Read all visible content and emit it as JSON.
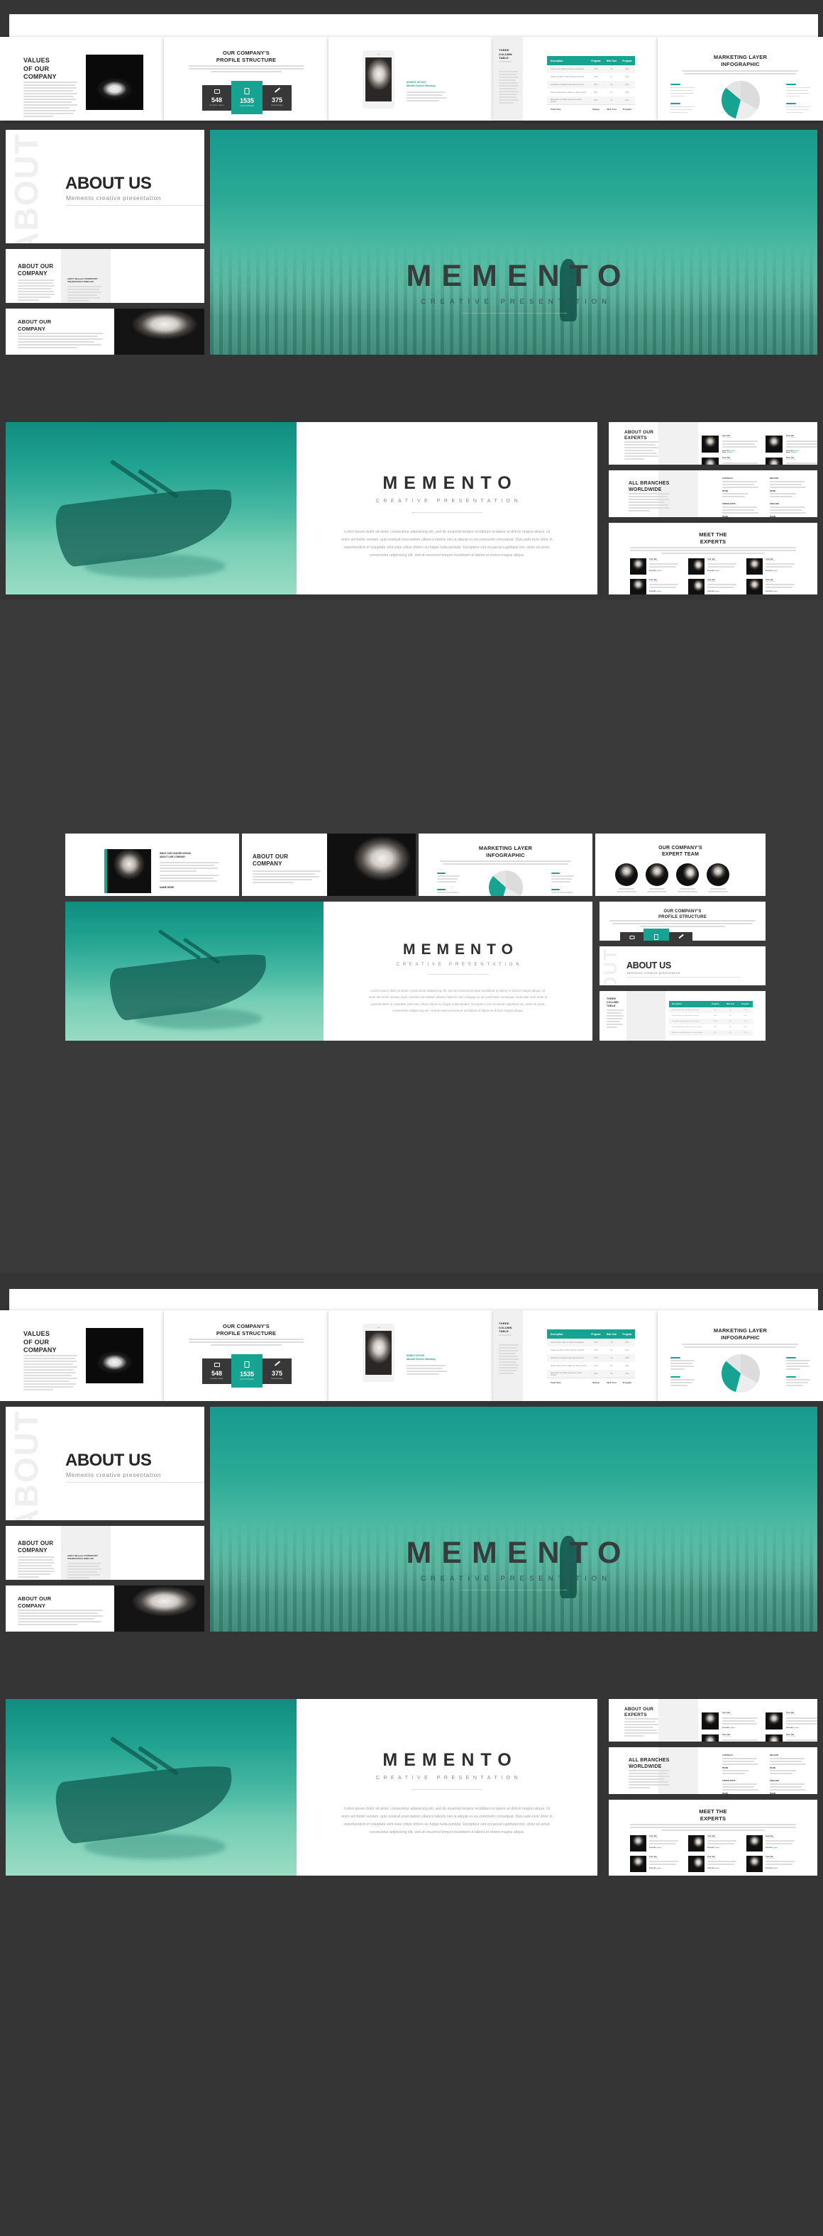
{
  "theme": {
    "accent": "#16a391",
    "dark": "#383838",
    "page_bg": "#353535",
    "text": "#262626",
    "muted": "#9a9a9a"
  },
  "brand": {
    "title": "MEMENTO",
    "subtitle": "CREATIVE PRESENTATION",
    "tagline": "Memento creative presentation"
  },
  "slides": {
    "values": {
      "title_lines": [
        "VALUES",
        "OF OUR",
        "COMPANY"
      ],
      "image": "apple-photo"
    },
    "profile_structure": {
      "title_lines": [
        "OUR COMPANY'S",
        "PROFILE STRUCTURE"
      ],
      "stats": [
        {
          "icon": "camera-icon",
          "value": "548",
          "label": "Creative Ideas"
        },
        {
          "icon": "bookmark-icon",
          "value": "1535",
          "label": "Lines Of Project"
        },
        {
          "icon": "pencil-icon",
          "value": "375",
          "label": "Great Design"
        }
      ]
    },
    "device_mockup": {
      "heading_lines": [
        "MOBILE DEVICE",
        "Mobile Device Mockup"
      ],
      "bullets": 4,
      "image": "kid-photo"
    },
    "three_column_table": {
      "title_lines": [
        "THREE",
        "COLUMN",
        "TABLE"
      ],
      "columns": [
        "Description",
        "Program",
        "Web Tool",
        "Program"
      ],
      "rows": [
        [
          "Lorem ipsum dolor sit amet consectetur",
          "2015",
          "Yes",
          "2015"
        ],
        [
          "Nullam id dolor id nibh ultricies vehicula",
          "2014",
          "No",
          "2014"
        ],
        [
          "Vestibulum id ligula porta felis euismod",
          "2013",
          "Yes",
          "2013"
        ],
        [
          "Donec ullamcorper nulla non metus auctor",
          "2012",
          "No",
          "2012"
        ],
        [
          "Maecenas sed diam eget risus varius blandit",
          "2011",
          "Yes",
          "2011"
        ],
        [
          "Cras justo odio dapibus ac facilisis in",
          "2010",
          "No",
          "2010"
        ]
      ],
      "footer": [
        "Total Time",
        "Rating",
        "Web Tool",
        "Program"
      ]
    },
    "marketing_layer": {
      "title_lines": [
        "MARKETING LAYER",
        "INFOGRAPHIC"
      ],
      "legend": [
        "Title Here",
        "Title Here",
        "Title Here",
        "Title Here"
      ],
      "chart": {
        "type": "pie",
        "slices": [
          54,
          28,
          18
        ]
      }
    },
    "about_us": {
      "title": "ABOUT US",
      "subtitle": "Memento creative presentation",
      "side_label": "ABOUT"
    },
    "about_company_text": {
      "title_lines": [
        "ABOUT OUR",
        "COMPANY"
      ],
      "right_heading_lines": [
        "ABOUT Memento POWERPOINT",
        "PRESENTATION TEMPLATE"
      ]
    },
    "about_company_photo": {
      "title_lines": [
        "ABOUT OUR",
        "COMPANY"
      ],
      "image": "woman-photo"
    },
    "about_experts": {
      "title_lines": [
        "ABOUT OUR",
        "EXPERTS"
      ],
      "experts": [
        {
          "name": "Your Job",
          "role": "Your Job Here",
          "follow_label": "FOLLOW",
          "follow_value": "@name",
          "contact_label": "Name",
          "contact_value": "@name"
        },
        {
          "name": "Your Job",
          "role": "Your Job Here",
          "follow_label": "FOLLOW",
          "follow_value": "@name",
          "contact_label": "Name",
          "contact_value": "@name"
        },
        {
          "name": "Your Job",
          "role": "Your Job Here",
          "follow_label": "FOLLOW",
          "follow_value": "@name",
          "contact_label": "Name",
          "contact_value": "@name"
        },
        {
          "name": "Your Job",
          "role": "Your Job Here",
          "follow_label": "FOLLOW",
          "follow_value": "@name",
          "contact_label": "Name",
          "contact_value": "@name"
        }
      ]
    },
    "branches": {
      "title_lines": [
        "ALL BRANCHES",
        "WORLDWIDE"
      ],
      "locations": [
        "AUSTRALIA",
        "BELGIUM",
        "UNITED STATE",
        "ENGLAND",
        "SOUTH AFRICA",
        "UNITED KINGDOM"
      ],
      "detail_label": "PHONE"
    },
    "meet_experts": {
      "title_lines": [
        "MEET THE",
        "EXPERTS"
      ],
      "count": 6
    },
    "leader_quote": {
      "heading_lines": [
        "WHAT OUR LEADER SAYING",
        "ABOUT OUR COMPANY"
      ],
      "signature": "NAME HERE"
    },
    "expert_team": {
      "title_lines": [
        "OUR COMPANY'S",
        "EXPERT TEAM"
      ],
      "members": 4
    }
  },
  "body_copy": {
    "memento_paragraph": "Lorem ipsum dolor sit amet, consectetur adipisicing elit, sed do eiusmod tempor incididunt ut labore et dolore magna aliqua. Ut enim ad minim veniam, quis nostrud exercitation ullamco laboris nisi ut aliquip ex ea commodo consequat. Duis aute irure dolor in reprehenderit in voluptate velit esse cillum dolore eu fugiat nulla pariatur. Excepteur sint occaecat cupidatat non, dolor sit amet, consectetur adipisicing elit, sed do eiusmod tempor incididunt ut labore et dolore magna aliqua."
  }
}
